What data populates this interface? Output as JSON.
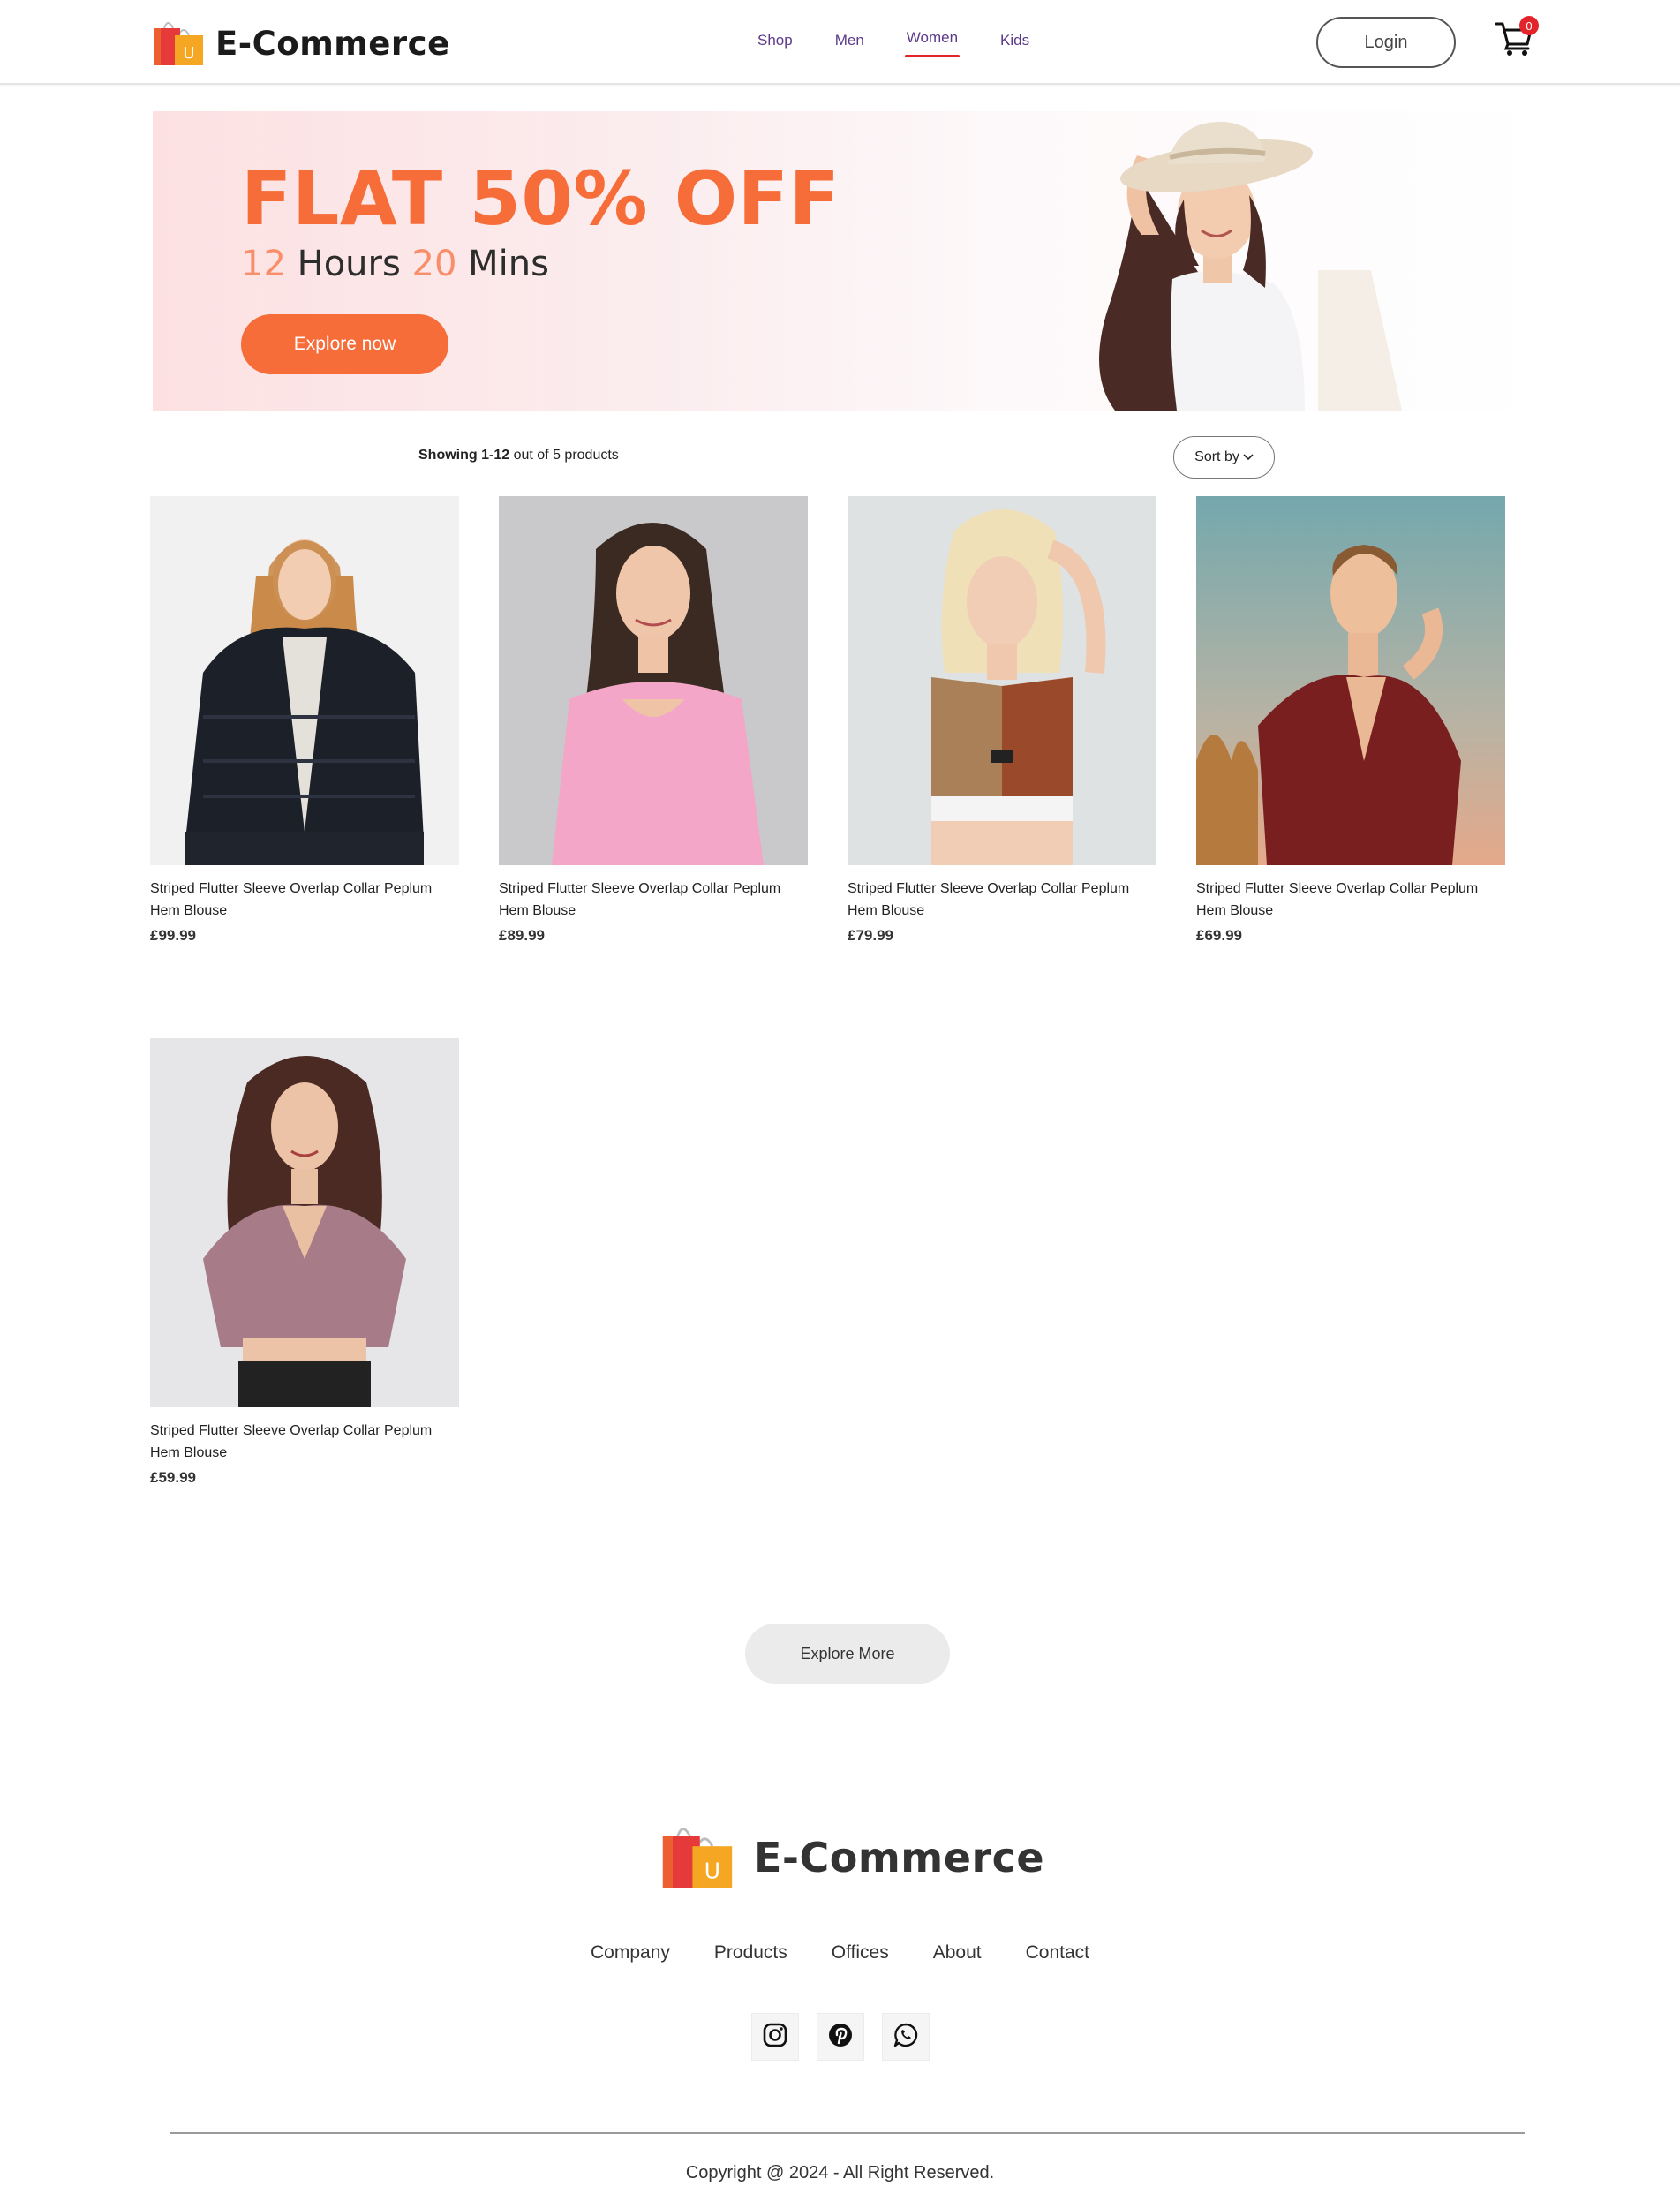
{
  "header": {
    "brand": "E-Commerce",
    "nav": [
      {
        "label": "Shop",
        "active": false
      },
      {
        "label": "Men",
        "active": false
      },
      {
        "label": "Women",
        "active": true
      },
      {
        "label": "Kids",
        "active": false
      }
    ],
    "login_label": "Login",
    "cart_count": "0"
  },
  "hero": {
    "headline": "FLAT 50% OFF",
    "timer_hours": "12",
    "timer_hours_label": "Hours",
    "timer_mins": "20",
    "timer_mins_label": "Mins",
    "cta_label": "Explore now"
  },
  "listing": {
    "showing_prefix": "Showing",
    "showing_range": "1-12",
    "showing_suffix": "out of 5 products",
    "sort_label": "Sort by"
  },
  "products": [
    {
      "title": "Striped Flutter Sleeve Overlap Collar Peplum Hem Blouse",
      "price": "£99.99",
      "image": "model-black-fur-jacket"
    },
    {
      "title": "Striped Flutter Sleeve Overlap Collar Peplum Hem Blouse",
      "price": "£89.99",
      "image": "model-pink-top"
    },
    {
      "title": "Striped Flutter Sleeve Overlap Collar Peplum Hem Blouse",
      "price": "£79.99",
      "image": "model-sports-crop-top"
    },
    {
      "title": "Striped Flutter Sleeve Overlap Collar Peplum Hem Blouse",
      "price": "£69.99",
      "image": "model-red-checked-blouse"
    },
    {
      "title": "Striped Flutter Sleeve Overlap Collar Peplum Hem Blouse",
      "price": "£59.99",
      "image": "model-mauve-blouse"
    }
  ],
  "explore_more_label": "Explore More",
  "footer": {
    "brand": "E-Commerce",
    "links": [
      "Company",
      "Products",
      "Offices",
      "About",
      "Contact"
    ],
    "socials": [
      "instagram-icon",
      "pinterest-icon",
      "whatsapp-icon"
    ],
    "copyright": "Copyright @ 2024 - All Right Reserved."
  },
  "colors": {
    "accent": "#f66d39",
    "nav_text": "#5b3a8a",
    "active_underline": "#e3242b",
    "badge": "#e3242b"
  }
}
